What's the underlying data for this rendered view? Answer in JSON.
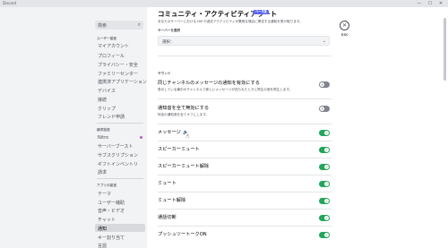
{
  "titlebar": {
    "app_name": "Discord",
    "minimize": "—",
    "maximize": "☐",
    "close": "✕"
  },
  "sidebar": {
    "search_placeholder": "検索",
    "sections": [
      {
        "heading": "ユーザー設定",
        "items": [
          "マイアカウント",
          "プロフィール",
          "プライバシー・安全",
          "ファミリーセンター",
          "連携済アプリケーション",
          "デバイス",
          "接続",
          "クリップ",
          "フレンド申請"
        ]
      },
      {
        "heading": "請求設定",
        "items": [
          "Nitro",
          "サーバーブースト",
          "サブスクリプション",
          "ギフトインベントリ",
          "請求"
        ]
      },
      {
        "heading": "アプリの設定",
        "items": [
          "テーマ",
          "ユーザー補助",
          "音声・ビデオ",
          "チャット",
          "通知",
          "キー割り当て",
          "言語"
        ]
      }
    ],
    "active_item": "通知"
  },
  "main": {
    "title": "コミュニティ・アクティビティアラート",
    "beta_badge": "ベータ版",
    "description": "あなたのサーバーにおける DM や過去アクティビティが異常な場合に警告する通知を受け取ります。",
    "server_field_label": "サーバーを選択",
    "server_select_value": "選択：",
    "sound_heading": "サウンド",
    "rows": [
      {
        "title": "同じチャンネルのメッセージの通知を有効にする",
        "desc": "表示している最中のチャンネルで新しいメッセージが送られたときに再生の音を再生します。",
        "enabled": false
      },
      {
        "title": "通知音を全て無効にする",
        "desc": "特定の通知音を全てオフにします。",
        "enabled": false
      },
      {
        "title": "メッセージ",
        "desc": "",
        "enabled": true
      },
      {
        "title": "スピーカーミュート",
        "desc": "",
        "enabled": true
      },
      {
        "title": "スピーカーミュート解除",
        "desc": "",
        "enabled": true
      },
      {
        "title": "ミュート",
        "desc": "",
        "enabled": true
      },
      {
        "title": "ミュート解除",
        "desc": "",
        "enabled": true
      },
      {
        "title": "通話切断",
        "desc": "",
        "enabled": true
      },
      {
        "title": "プッシュツートークON",
        "desc": "",
        "enabled": true
      }
    ],
    "toggle_on_mark": "✓",
    "toggle_off_mark": "✕",
    "speaker_icon": "🔈",
    "chevron": "⌄",
    "cursor": "☝"
  },
  "close_button": {
    "icon": "✕",
    "label": "ESC"
  },
  "colors": {
    "accent": "#5865f2",
    "toggle_on": "#23a55a",
    "toggle_off": "#80848e",
    "nitro_dot": "#c157c9"
  }
}
